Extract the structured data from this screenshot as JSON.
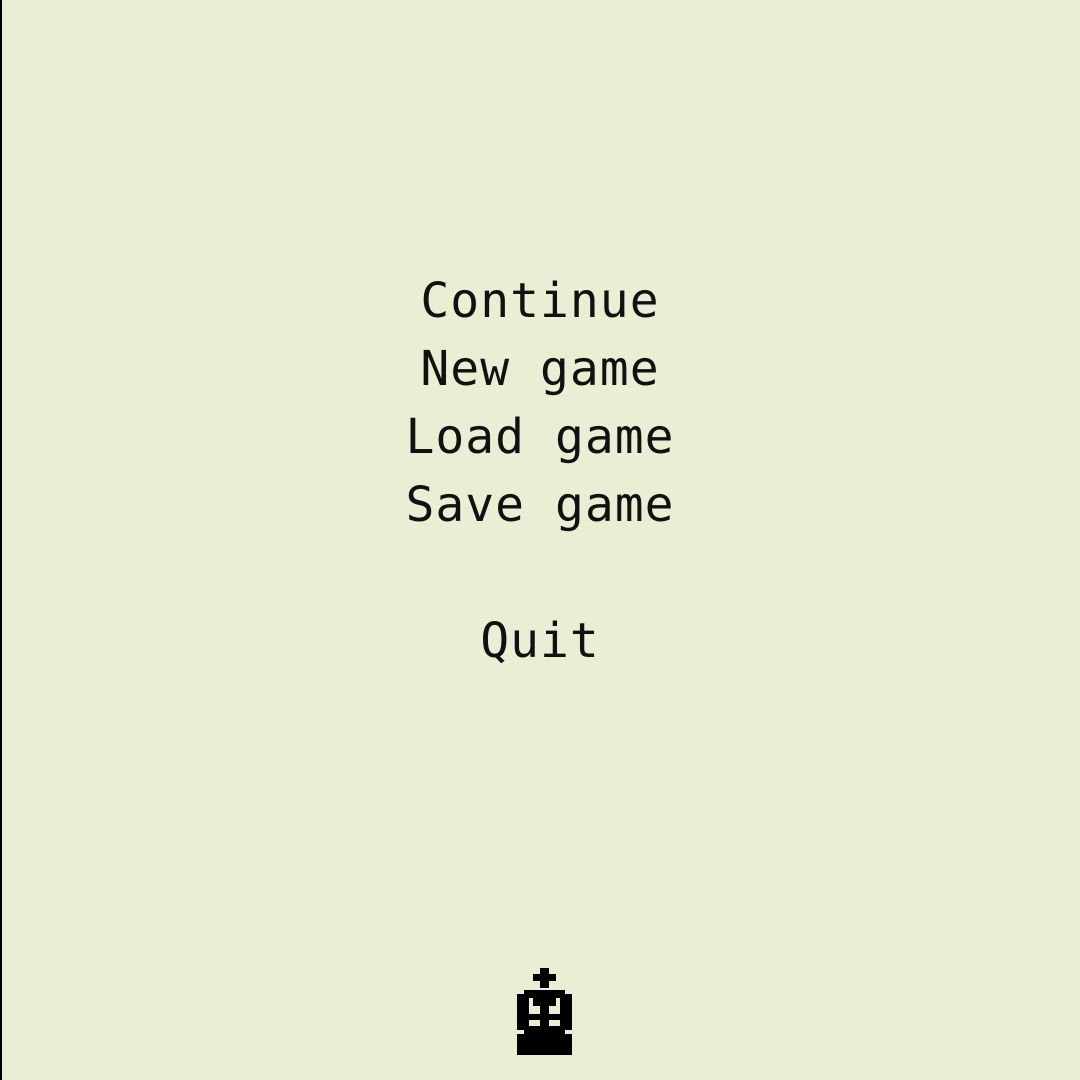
{
  "menu": {
    "items": [
      {
        "label": "Continue"
      },
      {
        "label": "New game"
      },
      {
        "label": "Load game"
      },
      {
        "label": "Save game"
      }
    ],
    "quit_label": "Quit"
  },
  "logo": {
    "icon": "king-chess-piece-icon",
    "color": "#000000"
  },
  "colors": {
    "background": "#ecedd5",
    "text": "#111111"
  }
}
